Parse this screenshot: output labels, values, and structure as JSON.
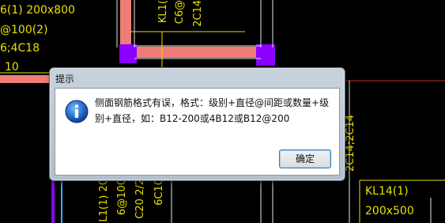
{
  "cad": {
    "labels_top_left": [
      "6(1) 200x800",
      "@100(2)",
      "6;4C18",
      "10"
    ],
    "label_kl1_top": "KL1(",
    "label_c6_top": "C6@",
    "label_2c14_top": "2C14",
    "label_right_vertical": "2C14;2C14",
    "label_kl14": "KL14(1)",
    "label_kl14_size": "200x500",
    "label_bottom_1": "L1(1) 20",
    "label_bottom_2": "6@100",
    "label_bottom_3": "C20 2/2",
    "label_bottom_4": "6C10"
  },
  "dialog": {
    "title": "提示",
    "icon": "info-icon",
    "message": "侧面钢筋格式有误，格式：级别+直径@间距或数量+级别+直径，如：B12-200或4B12或B12@200",
    "ok_label": "确定"
  }
}
